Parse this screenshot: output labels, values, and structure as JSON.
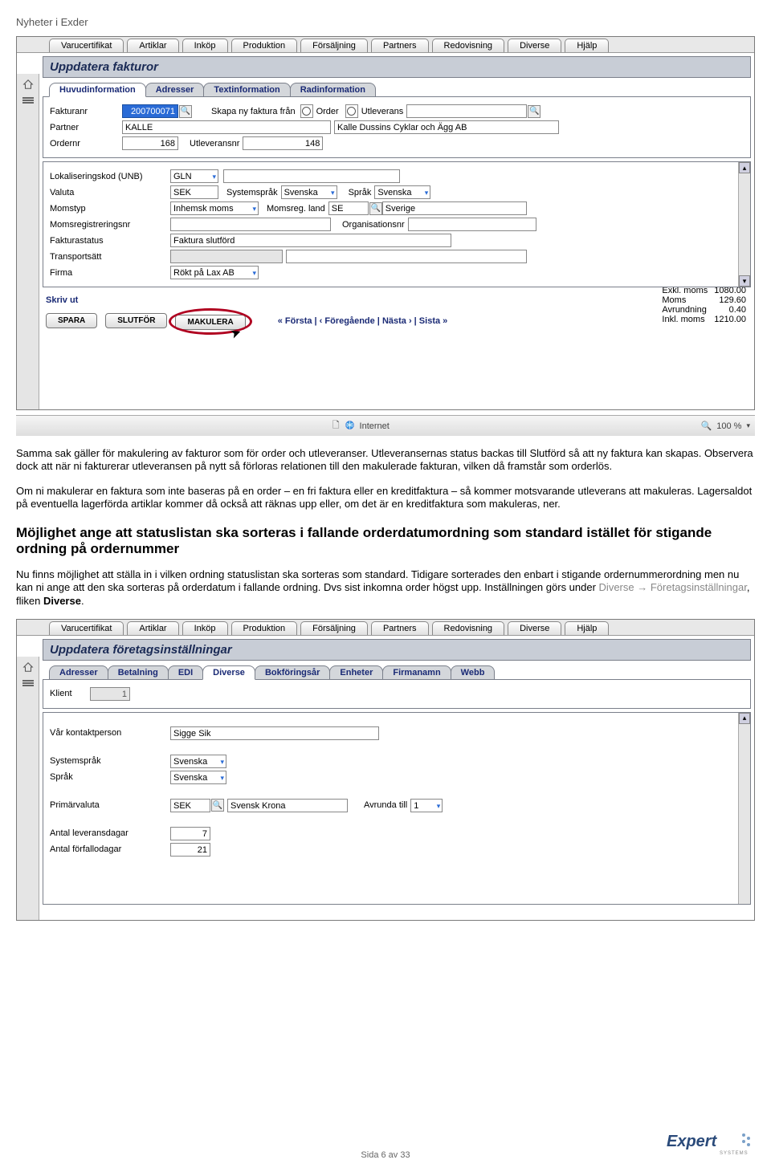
{
  "page_header": "Nyheter i Exder",
  "screenshot1": {
    "menu": [
      "Varucertifikat",
      "Artiklar",
      "Inköp",
      "Produktion",
      "Försäljning",
      "Partners",
      "Redovisning",
      "Diverse",
      "Hjälp"
    ],
    "title": "Uppdatera fakturor",
    "tabs": [
      "Huvudinformation",
      "Adresser",
      "Textinformation",
      "Radinformation"
    ],
    "active_tab": 0,
    "fields": {
      "fakturanr_label": "Fakturanr",
      "fakturanr_value": "200700071",
      "skapa_label": "Skapa ny faktura från",
      "order_opt": "Order",
      "utleverans_opt": "Utleverans",
      "partner_label": "Partner",
      "partner_value": "KALLE",
      "partner_name": "Kalle Dussins Cyklar och Ägg AB",
      "ordernr_label": "Ordernr",
      "ordernr_value": "168",
      "utleveransnr_label": "Utleveransnr",
      "utleveransnr_value": "148",
      "lokaliseringskod_label": "Lokaliseringskod (UNB)",
      "lokaliseringskod_value": "GLN",
      "valuta_label": "Valuta",
      "valuta_value": "SEK",
      "systemsprak_label": "Systemspråk",
      "systemsprak_value": "Svenska",
      "sprak_label": "Språk",
      "sprak_value": "Svenska",
      "momstyp_label": "Momstyp",
      "momstyp_value": "Inhemsk moms",
      "momsregland_label": "Momsreg. land",
      "momsregland_value": "SE",
      "momsregland_country": "Sverige",
      "momsregnr_label": "Momsregistreringsnr",
      "orgnr_label": "Organisationsnr",
      "fakturastatus_label": "Fakturastatus",
      "fakturastatus_value": "Faktura slutförd",
      "transportsatt_label": "Transportsätt",
      "firma_label": "Firma",
      "firma_value": "Rökt på Lax AB"
    },
    "skriv_ut": "Skriv ut",
    "actions": {
      "spara": "SPARA",
      "slutfor": "SLUTFÖR",
      "makulera": "MAKULERA"
    },
    "nav": "« Första | ‹ Föregående | Nästa › | Sista »",
    "totals": {
      "exkl_label": "Exkl. moms",
      "exkl_val": "1080.00",
      "moms_label": "Moms",
      "moms_val": "129.60",
      "avr_label": "Avrundning",
      "avr_val": "0.40",
      "inkl_label": "Inkl. moms",
      "inkl_val": "1210.00"
    },
    "statusbar": {
      "internet": "Internet",
      "zoom": "100 %"
    }
  },
  "para1": "Samma sak gäller för makulering av fakturor som för order och utleveranser. Utleveransernas status backas till Slutförd så att ny faktura kan skapas. Observera dock att när ni fakturerar utleveransen på nytt så förloras relationen till den makulerade fakturan, vilken då framstår som orderlös.",
  "para2": "Om ni makulerar en faktura som inte baseras på en order – en fri faktura eller en kreditfaktura – så kommer motsvarande utleverans att makuleras. Lagersaldot på eventuella lagerförda artiklar kommer då också att räknas upp eller, om det är en kreditfaktura som makuleras, ner.",
  "heading2": "Möjlighet ange att statuslistan ska sorteras i fallande orderdatumordning som standard istället för stigande ordning på ordernummer",
  "para3_a": "Nu finns möjlighet att ställa in i vilken ordning statuslistan ska sorteras som standard. Tidigare sorterades den enbart i stigande ordernummerordning men nu kan ni ange att den ska sorteras på orderdatum i fallande ordning. Dvs sist inkomna order högst upp. Inställningen görs under ",
  "para3_link1": "Diverse",
  "para3_link2": "Företagsinställningar",
  "para3_b": ", fliken ",
  "para3_c": "Diverse",
  "para3_d": ".",
  "screenshot2": {
    "menu": [
      "Varucertifikat",
      "Artiklar",
      "Inköp",
      "Produktion",
      "Försäljning",
      "Partners",
      "Redovisning",
      "Diverse",
      "Hjälp"
    ],
    "title": "Uppdatera företagsinställningar",
    "tabs": [
      "Adresser",
      "Betalning",
      "EDI",
      "Diverse",
      "Bokföringsår",
      "Enheter",
      "Firmanamn",
      "Webb"
    ],
    "active_tab": 3,
    "fields": {
      "klient_label": "Klient",
      "klient_value": "1",
      "kontakt_label": "Vår kontaktperson",
      "kontakt_value": "Sigge Sik",
      "systemsprak_label": "Systemspråk",
      "systemsprak_value": "Svenska",
      "sprak_label": "Språk",
      "sprak_value": "Svenska",
      "primarvaluta_label": "Primärvaluta",
      "primarvaluta_value": "SEK",
      "primarvaluta_name": "Svensk Krona",
      "avrunda_label": "Avrunda till",
      "avrunda_value": "1",
      "leveransdagar_label": "Antal leveransdagar",
      "leveransdagar_value": "7",
      "forfallodagar_label": "Antal förfallodagar",
      "forfallodagar_value": "21"
    }
  },
  "footer_text": "Sida 6 av 33",
  "logo_main": "Expert",
  "logo_sub": "SYSTEMS"
}
